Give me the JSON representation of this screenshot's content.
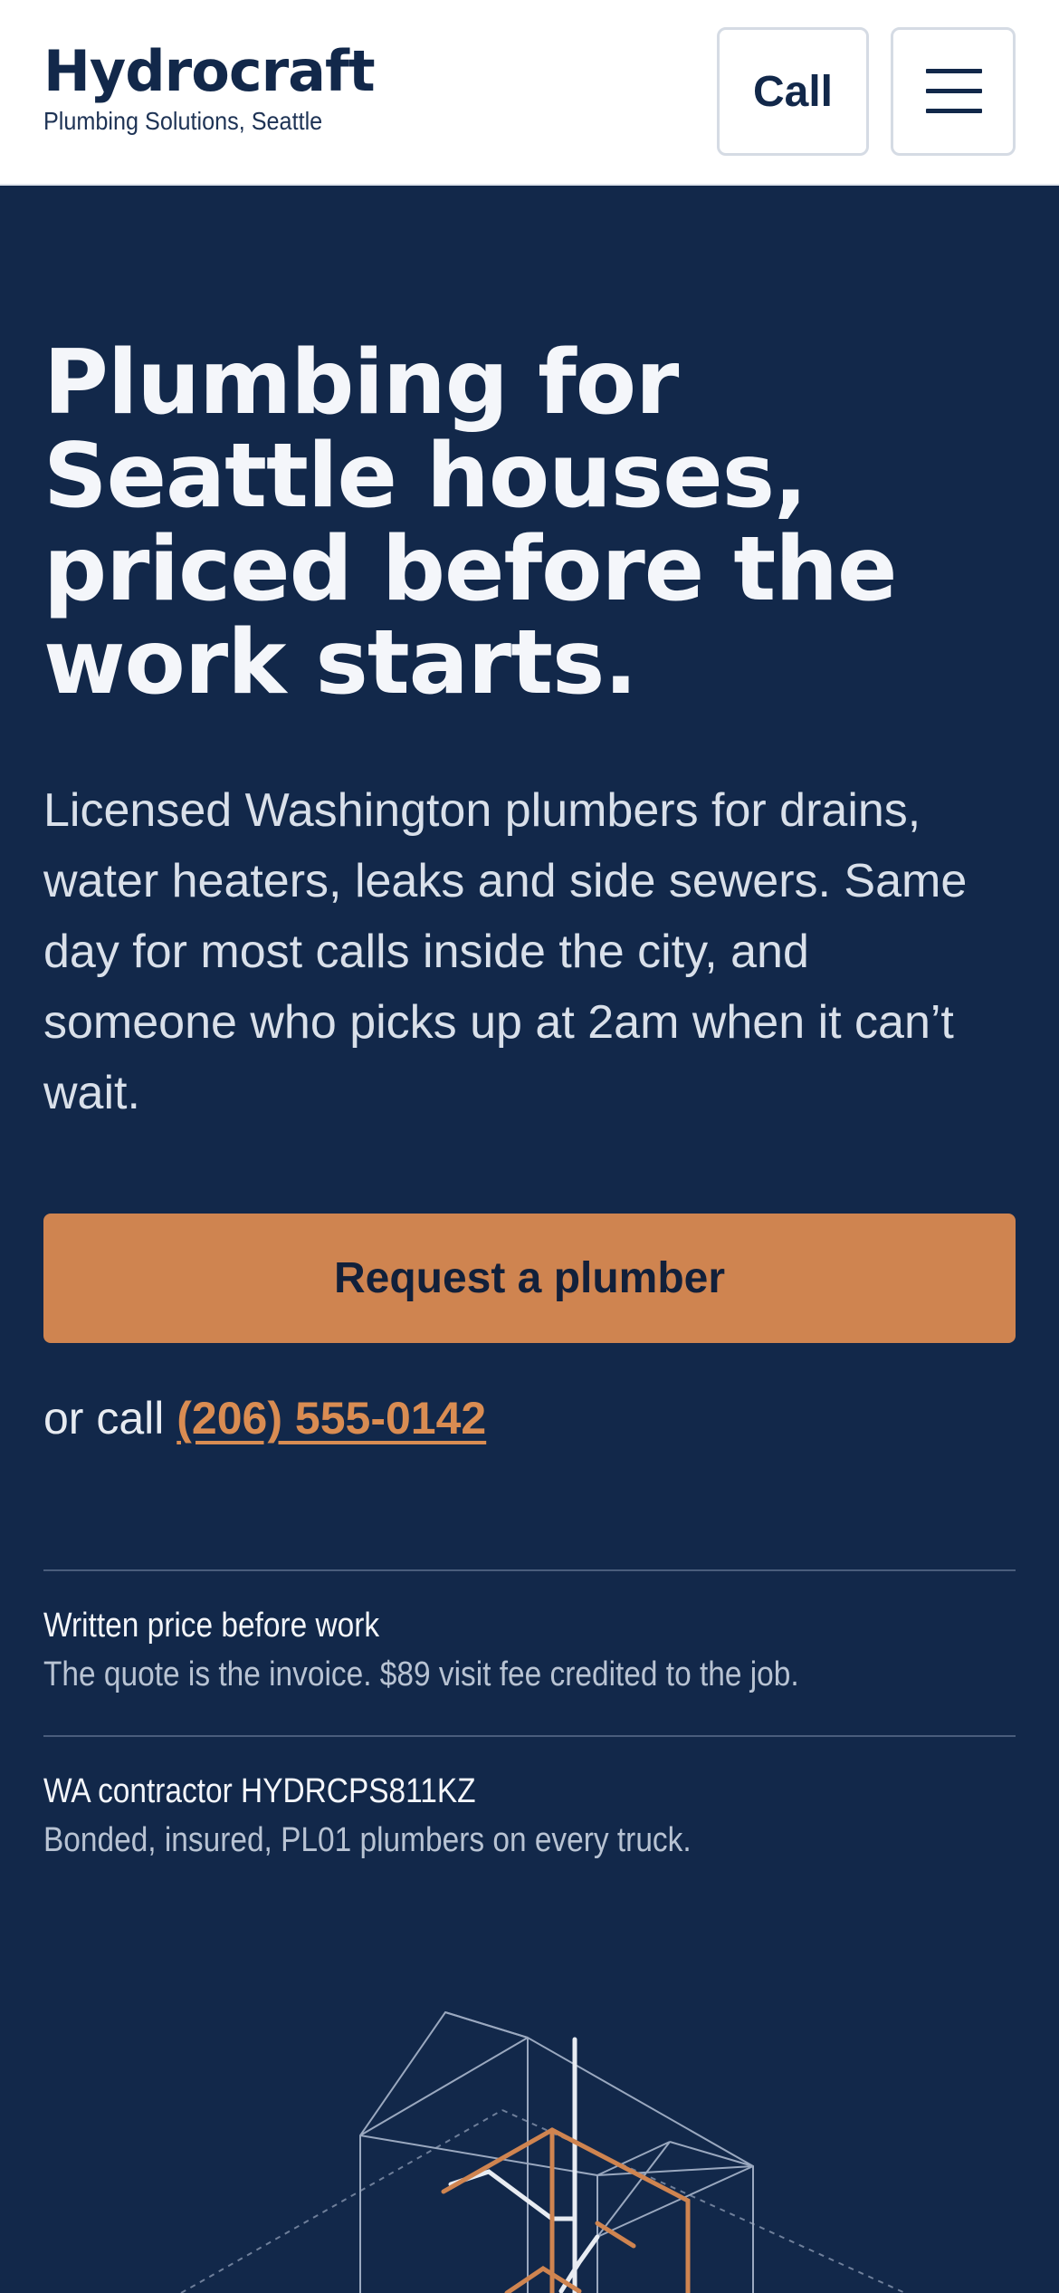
{
  "header": {
    "brand_name": "Hydrocraft",
    "brand_tagline": "Plumbing Solutions, Seattle",
    "call_label": "Call",
    "menu_icon": "hamburger-menu-icon"
  },
  "hero": {
    "title": "Plumbing for Seattle houses, priced before the work starts.",
    "body": "Licensed Washington plumbers for drains, water heaters, leaks and side sewers. Same day for most calls inside the city, and someone who picks up at 2am when it can’t wait.",
    "cta_label": "Request a plumber",
    "alt_call_prefix": "or call",
    "phone": "(206) 555-0142"
  },
  "features": [
    {
      "title": "Written price before work",
      "description": "The quote is the invoice. $89 visit fee credited to the job."
    },
    {
      "title": "WA contractor HYDRCPS811KZ",
      "description": "Bonded, insured, PL01 plumbers on every truck."
    }
  ],
  "colors": {
    "navy": "#12284a",
    "accent": "#cf8450",
    "link": "#d98c52",
    "white": "#ffffff"
  }
}
